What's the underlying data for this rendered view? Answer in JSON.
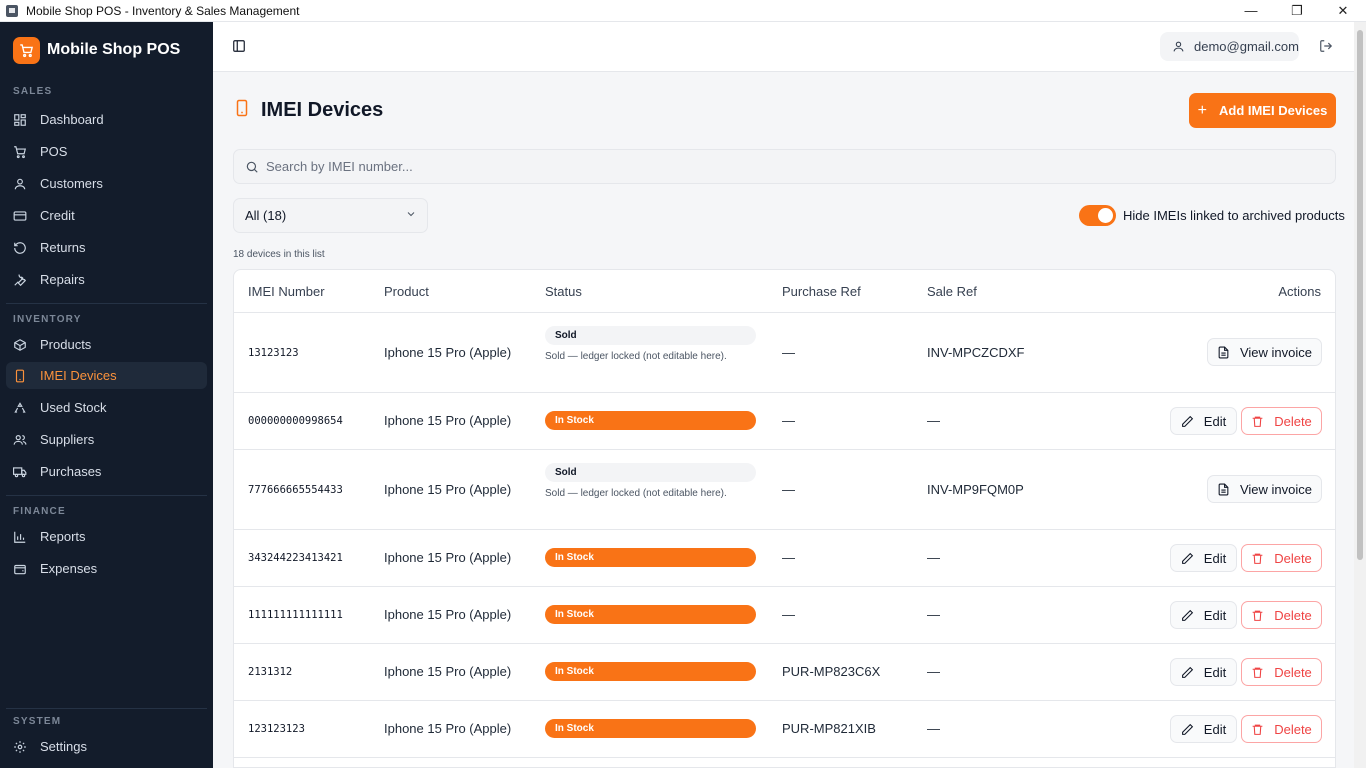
{
  "window": {
    "title": "Mobile Shop POS - Inventory & Sales Management",
    "min_glyph": "—",
    "max_glyph": "❐",
    "close_glyph": "✕"
  },
  "sidebar": {
    "brand": "Mobile Shop POS",
    "sections": {
      "sales": "SALES",
      "inventory": "INVENTORY",
      "finance": "FINANCE",
      "system": "SYSTEM"
    },
    "items": {
      "dashboard": "Dashboard",
      "pos": "POS",
      "customers": "Customers",
      "credit": "Credit",
      "returns": "Returns",
      "repairs": "Repairs",
      "products": "Products",
      "imei_devices": "IMEI Devices",
      "used_stock": "Used Stock",
      "suppliers": "Suppliers",
      "purchases": "Purchases",
      "reports": "Reports",
      "expenses": "Expenses",
      "settings": "Settings"
    },
    "active": "imei_devices"
  },
  "header": {
    "user_email": "demo@gmail.com"
  },
  "page": {
    "title": "IMEI Devices",
    "add_button": "Add IMEI Devices",
    "search_placeholder": "Search by IMEI number...",
    "filter_value": "All (18)",
    "toggle_label": "Hide IMEIs linked to archived products",
    "toggle_on": true,
    "count_text": "18 devices in this list"
  },
  "table": {
    "columns": {
      "imei": "IMEI Number",
      "product": "Product",
      "status": "Status",
      "purchase_ref": "Purchase Ref",
      "sale_ref": "Sale Ref",
      "actions": "Actions"
    },
    "sold_label": "Sold",
    "instock_label": "In Stock",
    "sold_note": "Sold — ledger locked (not editable here).",
    "view_invoice": "View invoice",
    "edit": "Edit",
    "delete": "Delete",
    "rows": [
      {
        "imei": "13123123",
        "product": "Iphone 15 Pro (Apple)",
        "status": "Sold",
        "purchase_ref": "—",
        "sale_ref": "INV-MPCZCDXF"
      },
      {
        "imei": "000000000998654",
        "product": "Iphone 15 Pro (Apple)",
        "status": "In Stock",
        "purchase_ref": "—",
        "sale_ref": "—"
      },
      {
        "imei": "777666665554433",
        "product": "Iphone 15 Pro (Apple)",
        "status": "Sold",
        "purchase_ref": "—",
        "sale_ref": "INV-MP9FQM0P"
      },
      {
        "imei": "343244223413421",
        "product": "Iphone 15 Pro (Apple)",
        "status": "In Stock",
        "purchase_ref": "—",
        "sale_ref": "—"
      },
      {
        "imei": "111111111111111",
        "product": "Iphone 15 Pro (Apple)",
        "status": "In Stock",
        "purchase_ref": "—",
        "sale_ref": "—"
      },
      {
        "imei": "2131312",
        "product": "Iphone 15 Pro (Apple)",
        "status": "In Stock",
        "purchase_ref": "PUR-MP823C6X",
        "sale_ref": "—"
      },
      {
        "imei": "123123123",
        "product": "Iphone 15 Pro (Apple)",
        "status": "In Stock",
        "purchase_ref": "PUR-MP821XIB",
        "sale_ref": "—"
      }
    ]
  },
  "colors": {
    "accent": "#f97316",
    "sidebar_bg": "#131c2b",
    "danger": "#ef4444"
  }
}
